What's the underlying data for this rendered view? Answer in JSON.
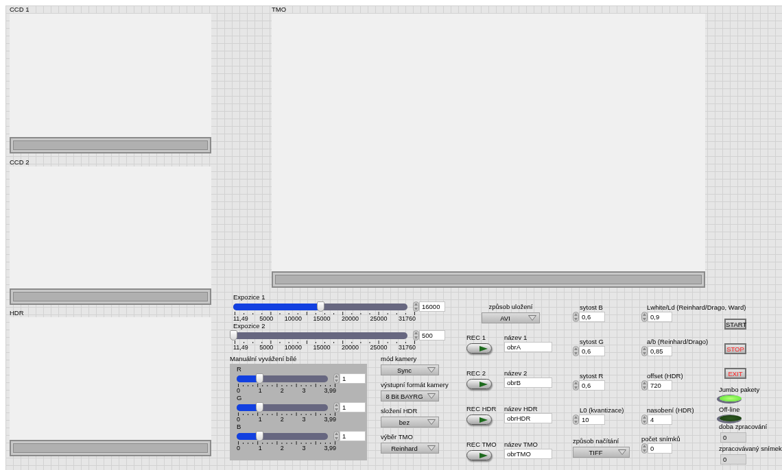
{
  "left_displays": [
    {
      "label": "CCD 1"
    },
    {
      "label": "CCD 2"
    },
    {
      "label": "HDR"
    }
  ],
  "tmo_display": {
    "label": "TMO"
  },
  "exposure_sliders": [
    {
      "label": "Expozice 1",
      "level": 0.5,
      "ticks": [
        "11,49",
        "5000",
        "10000",
        "15000",
        "20000",
        "25000",
        "31760"
      ],
      "value": "16000"
    },
    {
      "label": "Expozice 2",
      "level": 0.0,
      "ticks": [
        "11,49",
        "5000",
        "10000",
        "15000",
        "20000",
        "25000",
        "31760"
      ],
      "value": "500"
    }
  ],
  "white_balance": {
    "label": "Manuální vyvážení bílé",
    "sliders": [
      {
        "label": "R",
        "level": 0.25,
        "ticks": [
          "0",
          "1",
          "2",
          "3",
          "3,99"
        ],
        "value": "1"
      },
      {
        "label": "G",
        "level": 0.25,
        "ticks": [
          "0",
          "1",
          "2",
          "3",
          "3,99"
        ],
        "value": "1"
      },
      {
        "label": "B",
        "level": 0.25,
        "ticks": [
          "0",
          "1",
          "2",
          "3",
          "3,99"
        ],
        "value": "1"
      }
    ]
  },
  "camera_dropdowns": [
    {
      "label": "mód kamery",
      "value": "Sync"
    },
    {
      "label": "výstupní formát kamery",
      "value": "8 Bit BAYRG"
    },
    {
      "label": "složení HDR",
      "value": "bez"
    },
    {
      "label": "výběr TMO",
      "value": "Reinhard"
    }
  ],
  "save_mode": {
    "label": "způsob uložení",
    "value": "AVI"
  },
  "recorders": [
    {
      "button": "REC 1",
      "name_label": "název 1",
      "name_value": "obrA"
    },
    {
      "button": "REC 2",
      "name_label": "název 2",
      "name_value": "obrB"
    },
    {
      "button": "REC HDR",
      "name_label": "název HDR",
      "name_value": "obrHDR"
    },
    {
      "button": "REC TMO",
      "name_label": "název TMO",
      "name_value": "obrTMO"
    }
  ],
  "saturation_controls": [
    {
      "label": "sytost B",
      "value": "0,6"
    },
    {
      "label": "sytost G",
      "value": "0,6"
    },
    {
      "label": "sytost R",
      "value": "0,6"
    },
    {
      "label": "L0 (kvantizace)",
      "value": "10"
    }
  ],
  "load_mode": {
    "label": "způsob načítání",
    "value": "TIFF"
  },
  "tmo_params": [
    {
      "label": "Lwhite/Ld (Reinhard/Drago, Ward)",
      "value": "0,9"
    },
    {
      "label": "a/b (Reinhard/Drago)",
      "value": "0,85"
    },
    {
      "label": "offset (HDR)",
      "value": "720"
    },
    {
      "label": "nasobení (HDR)",
      "value": "4"
    },
    {
      "label": "počet snímků",
      "value": "0"
    }
  ],
  "action_buttons": [
    {
      "label": "START",
      "kind": "start"
    },
    {
      "label": "STOP",
      "kind": "stop"
    },
    {
      "label": "EXIT",
      "kind": "exit"
    }
  ],
  "leds": [
    {
      "label": "Jumbo pakety",
      "on": true
    },
    {
      "label": "Off-line",
      "on": false
    }
  ],
  "indicators": [
    {
      "label": "doba zpracování",
      "value": "0"
    },
    {
      "label": "zpracovávaný snímek",
      "value": "0"
    }
  ]
}
